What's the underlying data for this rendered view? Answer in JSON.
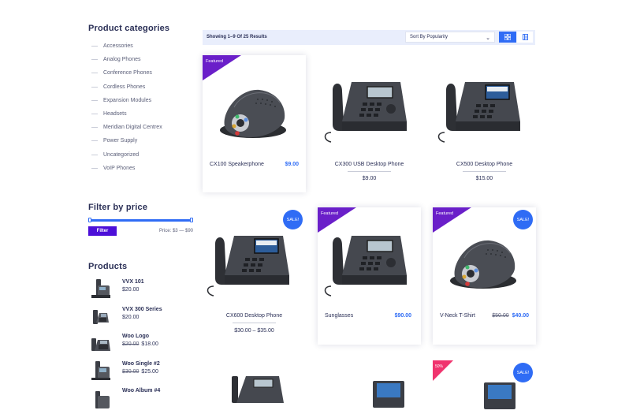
{
  "sidebar": {
    "categories_title": "Product categories",
    "categories": [
      "Accessories",
      "Analog Phones",
      "Conference Phones",
      "Cordless Phones",
      "Expansion Modules",
      "Headsets",
      "Meridian Digital Centrex",
      "Power Supply",
      "Uncategorized",
      "VoIP Phones"
    ],
    "price_filter": {
      "title": "Filter by price",
      "button": "Filter",
      "range_text": "Price: $3 — $90"
    },
    "products_title": "Products",
    "products": [
      {
        "name": "VVX 101",
        "price": "$20.00",
        "old_price": ""
      },
      {
        "name": "VVX 300 Series",
        "price": "$20.00",
        "old_price": ""
      },
      {
        "name": "Woo Logo",
        "price": "$18.00",
        "old_price": "$20.00"
      },
      {
        "name": "Woo Single #2",
        "price": "$25.00",
        "old_price": "$30.00"
      },
      {
        "name": "Woo Album #4",
        "price": "",
        "old_price": ""
      }
    ]
  },
  "toolbar": {
    "result_count": "Showing 1–9 Of 25 Results",
    "sort_value": "Sort By Popularity"
  },
  "products": [
    {
      "name": "CX100 Speakerphone",
      "price": "$9.00",
      "badge": "Featured",
      "sale": ""
    },
    {
      "name": "CX300 USB Desktop Phone",
      "price": "$9.00",
      "badge": "",
      "sale": ""
    },
    {
      "name": "CX500 Desktop Phone",
      "price": "$15.00",
      "badge": "",
      "sale": ""
    },
    {
      "name": "CX600 Desktop Phone",
      "price": "$30.00 – $35.00",
      "badge": "",
      "sale": "SALE!"
    },
    {
      "name": "Sunglasses",
      "price": "$90.00",
      "badge": "Featured",
      "sale": ""
    },
    {
      "name": "V-Neck T-Shirt",
      "price": "$40.00",
      "old_price": "$50.00",
      "badge": "Featured",
      "sale": "SALE!"
    },
    {
      "badge": "",
      "sale": ""
    },
    {
      "badge": "",
      "sale": ""
    },
    {
      "badge": "50%",
      "sale": "SALE!"
    }
  ],
  "colors": {
    "accent": "#2f6cf5",
    "ribbon": "#6a1fc9",
    "filter_button": "#4c0fd8",
    "pink_ribbon": "#f0346e"
  }
}
